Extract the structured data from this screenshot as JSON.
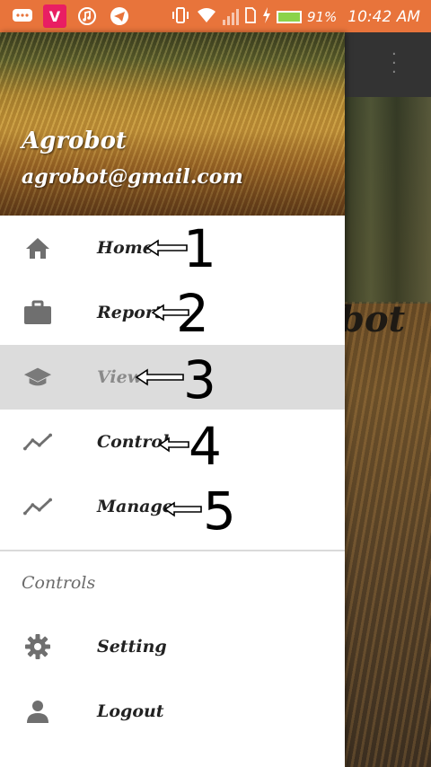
{
  "status_bar": {
    "battery": "91%",
    "time": "10:42 AM",
    "app_icons": [
      "chat-icon",
      "vidmate-icon",
      "music-icon",
      "telegram-icon"
    ],
    "v_label": "V"
  },
  "drawer": {
    "header": {
      "name": "Agrobot",
      "email": "agrobot@gmail.com"
    },
    "items": [
      {
        "label": "Home",
        "icon": "home-icon",
        "annotation": "1"
      },
      {
        "label": "Report",
        "icon": "briefcase-icon",
        "annotation": "2"
      },
      {
        "label": "View",
        "icon": "school-icon",
        "annotation": "3",
        "selected": true
      },
      {
        "label": "Control",
        "icon": "trending-icon",
        "annotation": "4"
      },
      {
        "label": "Manage",
        "icon": "trending-icon",
        "annotation": "5"
      }
    ],
    "section_title": "Controls",
    "controls": [
      {
        "label": "Setting",
        "icon": "gear-icon"
      },
      {
        "label": "Logout",
        "icon": "person-icon"
      }
    ]
  },
  "background_app": {
    "title_fragment": "bot"
  },
  "colors": {
    "status_bar": "#e8743b",
    "selected_row": "#dcdcdc",
    "icon": "#6f6f6f"
  }
}
